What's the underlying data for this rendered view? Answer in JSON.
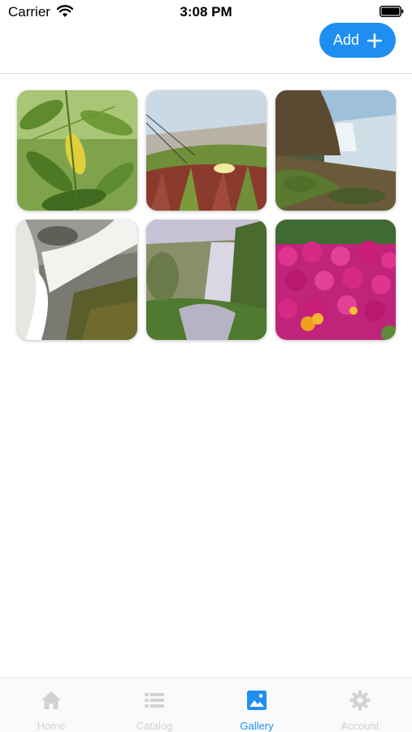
{
  "status_bar": {
    "carrier": "Carrier",
    "time": "3:08 PM"
  },
  "header": {
    "add_label": "Add"
  },
  "gallery": {
    "photos": [
      {
        "subject": "leaves"
      },
      {
        "subject": "ice-plant-flowers"
      },
      {
        "subject": "coastal-waterfall"
      },
      {
        "subject": "waterfall-rocks"
      },
      {
        "subject": "misty-waterfall"
      },
      {
        "subject": "pink-flowers"
      }
    ]
  },
  "tabbar": {
    "tabs": [
      {
        "label": "Home",
        "icon": "home-icon",
        "active": false
      },
      {
        "label": "Catalog",
        "icon": "list-icon",
        "active": false
      },
      {
        "label": "Gallery",
        "icon": "image-icon",
        "active": true
      },
      {
        "label": "Account",
        "icon": "gear-icon",
        "active": false
      }
    ]
  },
  "colors": {
    "accent": "#1E8FF0",
    "inactive_tab": "#d2d2d2"
  }
}
